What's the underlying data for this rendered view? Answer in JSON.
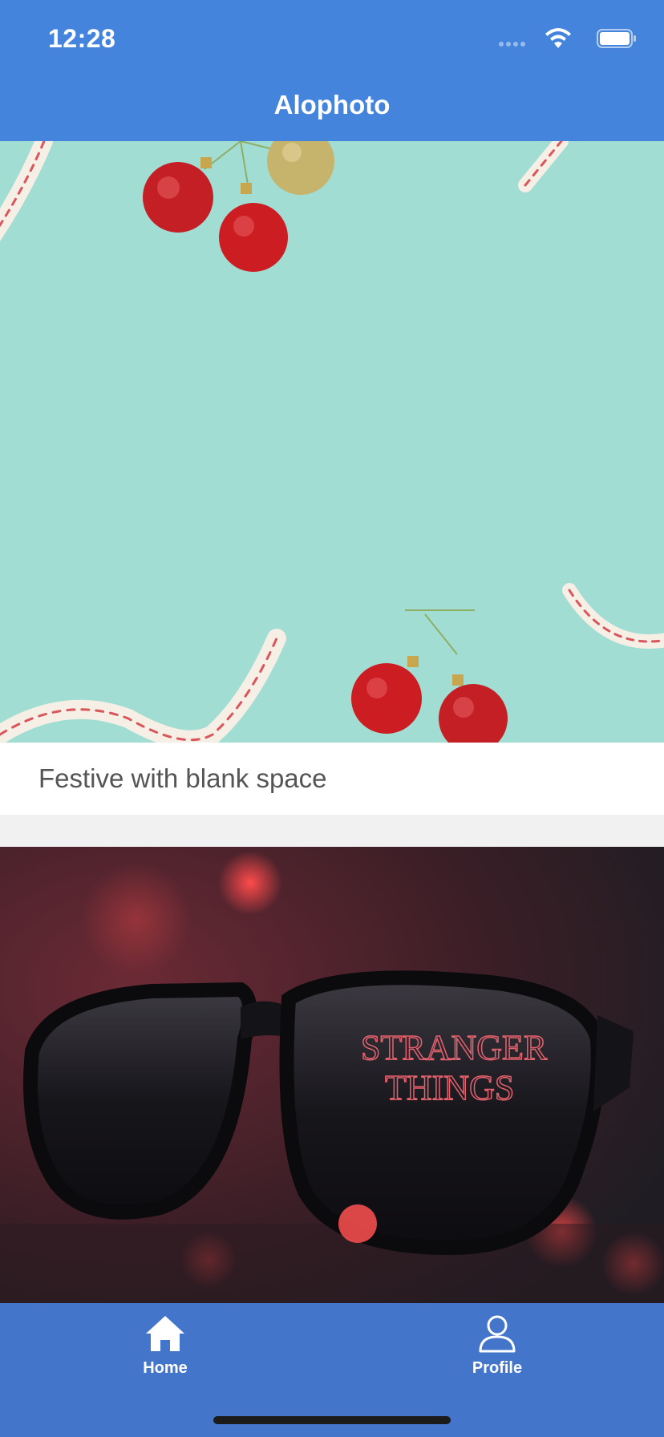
{
  "status_bar": {
    "time": "12:28",
    "icons": [
      "signal-icon",
      "wifi-icon",
      "battery-icon"
    ]
  },
  "nav": {
    "title": "Alophoto"
  },
  "feed": {
    "items": [
      {
        "caption": "Festive with blank space",
        "image": "festive-ornaments-photo"
      },
      {
        "caption": "",
        "image": "sunglasses-stranger-things-photo",
        "image_text": "STRANGER THINGS"
      }
    ]
  },
  "tabbar": {
    "items": [
      {
        "label": "Home",
        "icon": "home-icon",
        "selected": true
      },
      {
        "label": "Profile",
        "icon": "profile-icon",
        "selected": false
      }
    ]
  },
  "colors": {
    "header_bg": "#4484dc",
    "tabbar_bg": "#4375cb",
    "feed_bg": "#f1f1f1"
  }
}
